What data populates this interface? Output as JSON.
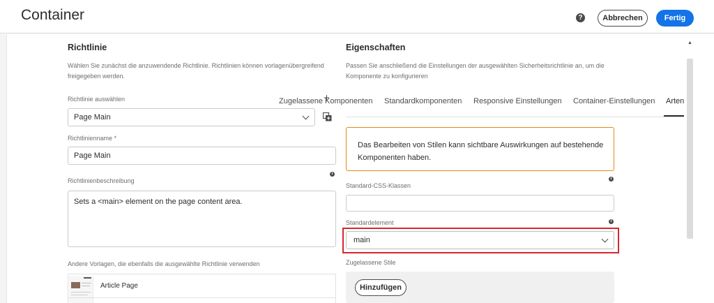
{
  "header": {
    "title": "Container",
    "help_icon": "?",
    "cancel_label": "Abbrechen",
    "done_label": "Fertig"
  },
  "policy": {
    "heading": "Richtlinie",
    "description_line1": "Wählen Sie zunächst die anzuwendende Richtlinie. Richtlinien können vorlagenübergreifend",
    "description_line2": "freigegeben werden.",
    "select_label": "Richtlinie auswählen",
    "select_value": "Page Main",
    "add_icon": "+",
    "name_label": "Richtlinienname *",
    "name_value": "Page Main",
    "desc_label": "Richtlinienbeschreibung",
    "desc_value": "Sets a <main> element on the page content area.",
    "other_templates_label": "Andere Vorlagen, die ebenfalls die ausgewählte Richtlinie verwenden",
    "templates": [
      {
        "name": "Article Page"
      }
    ]
  },
  "properties": {
    "heading": "Eigenschaften",
    "description_line1": "Passen Sie anschließend die Einstellungen der ausgewählten Sicherheitsrichtlinie an, um die",
    "description_line2": "Komponente zu konfigurieren",
    "tabs": [
      {
        "label": "Zugelassene Komponenten"
      },
      {
        "label": "Standardkomponenten"
      },
      {
        "label": "Responsive Einstellungen"
      },
      {
        "label": "Container-Einstellungen"
      },
      {
        "label": "Arten"
      }
    ],
    "warning_line1": "Das Bearbeiten von Stilen kann sichtbare Auswirkungen auf bestehende",
    "warning_line2": "Komponenten haben.",
    "css_label": "Standard-CSS-Klassen",
    "css_value": "",
    "element_label": "Standardelement",
    "element_value": "main",
    "allowed_styles_label": "Zugelassene Stile",
    "add_label": "Hinzufügen"
  },
  "icons": {
    "info": "i",
    "scroll_up": "▲"
  },
  "colors": {
    "primary": "#1473e6",
    "warning_border": "#e68619",
    "highlight": "#d7262c"
  }
}
